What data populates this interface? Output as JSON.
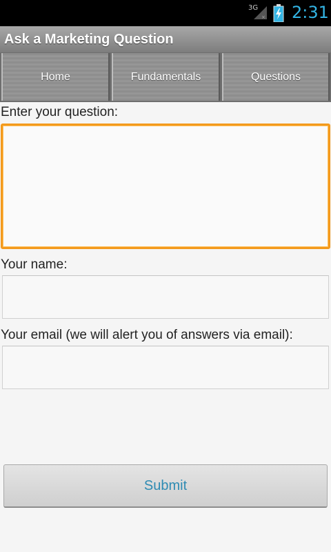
{
  "status_bar": {
    "network": "3G",
    "time": "2:31",
    "signal_icon": "signal-icon",
    "battery_icon": "battery-charging-icon"
  },
  "title_bar": {
    "title": "Ask a Marketing Question"
  },
  "tabs": [
    {
      "label": "Home"
    },
    {
      "label": "Fundamentals"
    },
    {
      "label": "Questions"
    }
  ],
  "form": {
    "question_label": "Enter your question:",
    "question_value": "",
    "name_label": "Your name:",
    "name_value": "",
    "email_label": "Your email (we will alert you of answers via email):",
    "email_value": "",
    "submit_label": "Submit"
  },
  "colors": {
    "accent": "#f39a1d",
    "status_text": "#33b5e5",
    "submit_text": "#2e8bb3"
  }
}
